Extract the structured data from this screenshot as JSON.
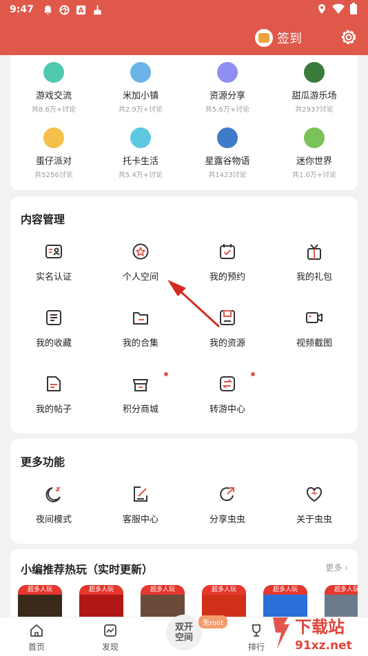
{
  "status_bar": {
    "time": "9:47"
  },
  "header": {
    "signin_label": "签到"
  },
  "forums": [
    {
      "name": "游戏交流",
      "count": "共8.8万+讨论",
      "color": "#4fc9b0"
    },
    {
      "name": "米加小镇",
      "count": "共2.9万+讨论",
      "color": "#6bb4e8"
    },
    {
      "name": "资源分享",
      "count": "共5.6万+讨论",
      "color": "#8e8ff0"
    },
    {
      "name": "甜瓜游乐场",
      "count": "共2937讨论",
      "color": "#3a7a3a"
    },
    {
      "name": "蛋仔派对",
      "count": "共5256讨论",
      "color": "#f5c04a"
    },
    {
      "name": "托卡生活",
      "count": "共5.4万+讨论",
      "color": "#5ec8e0"
    },
    {
      "name": "星露谷物语",
      "count": "共1423讨论",
      "color": "#3e7bc8"
    },
    {
      "name": "迷你世界",
      "count": "共1.0万+讨论",
      "color": "#7ac25a"
    }
  ],
  "content_management": {
    "title": "内容管理",
    "items": [
      {
        "label": "实名认证",
        "icon": "id-card-icon"
      },
      {
        "label": "个人空间",
        "icon": "star-badge-icon"
      },
      {
        "label": "我的预约",
        "icon": "calendar-check-icon"
      },
      {
        "label": "我的礼包",
        "icon": "gift-icon"
      },
      {
        "label": "我的收藏",
        "icon": "collection-icon"
      },
      {
        "label": "我的合集",
        "icon": "folder-icon"
      },
      {
        "label": "我的资源",
        "icon": "save-icon"
      },
      {
        "label": "视频截图",
        "icon": "video-icon"
      },
      {
        "label": "我的帖子",
        "icon": "post-icon"
      },
      {
        "label": "积分商城",
        "icon": "store-icon"
      },
      {
        "label": "转游中心",
        "icon": "transfer-icon"
      }
    ]
  },
  "more_features": {
    "title": "更多功能",
    "items": [
      {
        "label": "夜间模式",
        "icon": "moon-icon"
      },
      {
        "label": "客服中心",
        "icon": "edit-icon"
      },
      {
        "label": "分享虫虫",
        "icon": "share-icon"
      },
      {
        "label": "关于虫虫",
        "icon": "heart-icon"
      }
    ]
  },
  "recommend": {
    "title": "小编推荐热玩（实时更新）",
    "more_label": "更多",
    "tag": "超多人玩",
    "game_colors": [
      "#3a2a1a",
      "#b01818",
      "#6b4a3a",
      "#d03018",
      "#2b6fd8",
      "#6a7a8a"
    ]
  },
  "bottom_nav": {
    "home": "首页",
    "discover": "发现",
    "center_line1": "双开",
    "center_line2": "空间",
    "free_root": "免root",
    "rank": "排行"
  },
  "watermark": {
    "line1": "下载站",
    "line2": "91xz.net"
  },
  "colors": {
    "header": "#e0584a",
    "accent_dot": "#e0584a",
    "arrow": "#d42b22"
  }
}
